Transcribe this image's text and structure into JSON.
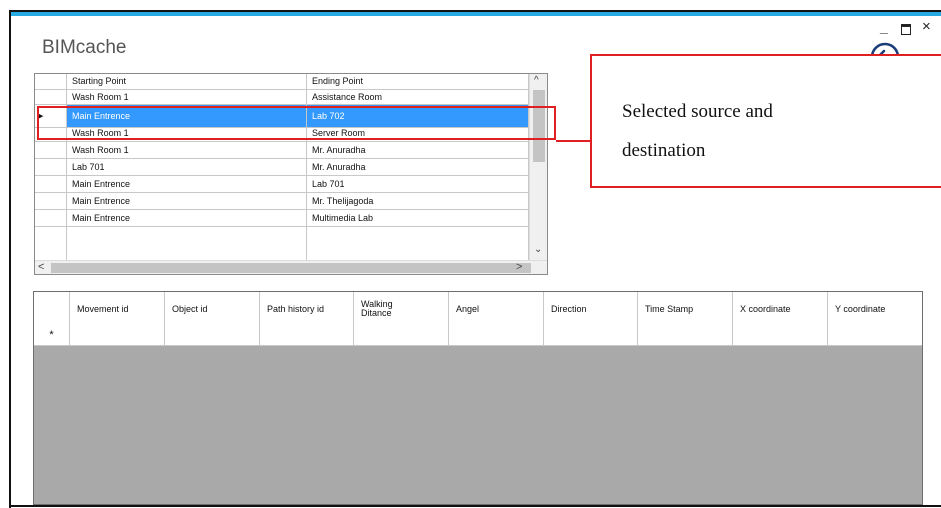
{
  "window": {
    "title": "BIMcache",
    "minimize_glyph": "_",
    "close_glyph": "×",
    "back_icon": "back-arrow-icon",
    "accent_color": "#27a9e1"
  },
  "routes_grid": {
    "columns": [
      "Starting Point",
      "Ending Point"
    ],
    "rows": [
      {
        "start": "Wash Room 1",
        "end": "Assistance Room"
      },
      {
        "start": "Main Entrence",
        "end": "Lab 702"
      },
      {
        "start": "Wash Room 1",
        "end": "Server Room"
      },
      {
        "start": "Wash Room 1",
        "end": "Mr. Anuradha"
      },
      {
        "start": "Lab 701",
        "end": "Mr. Anuradha"
      },
      {
        "start": "Main Entrence",
        "end": "Lab 701"
      },
      {
        "start": "Main Entrence",
        "end": "Mr. Thelijagoda"
      },
      {
        "start": "Main Entrence",
        "end": "Multimedia Lab"
      }
    ],
    "selected_index": 1,
    "selection_color": "#3399ff",
    "row_marker": "▶",
    "scroll_up": "^",
    "scroll_down": "⌄",
    "scroll_left": "<",
    "scroll_right": ">"
  },
  "callout": {
    "text_line1": "Selected source and",
    "text_line2": "destination",
    "color": "#e02020"
  },
  "movement_grid": {
    "columns": [
      "Movement id",
      "Object id",
      "Path history id",
      "Walking Ditance",
      "Angel",
      "Direction",
      "Time Stamp",
      "X coordinate",
      "Y coordinate"
    ],
    "new_row_marker": "*",
    "empty_area_color": "#a9a9a9"
  }
}
